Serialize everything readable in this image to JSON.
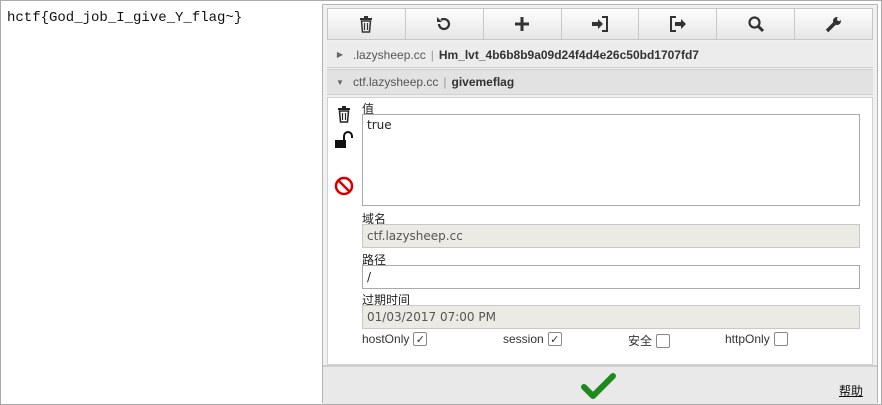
{
  "page": {
    "text": "hctf{God_job_I_give_Y_flag~}"
  },
  "toolbar": {
    "buttons": [
      {
        "name": "delete-all-button",
        "icon": "trash-icon"
      },
      {
        "name": "reset-button",
        "icon": "refresh-icon"
      },
      {
        "name": "add-cookie-button",
        "icon": "plus-icon"
      },
      {
        "name": "import-button",
        "icon": "sign-in-icon"
      },
      {
        "name": "export-button",
        "icon": "sign-out-icon"
      },
      {
        "name": "search-button",
        "icon": "search-icon"
      },
      {
        "name": "settings-button",
        "icon": "wrench-icon"
      }
    ]
  },
  "cookies": [
    {
      "domain": ".lazysheep.cc",
      "sep": "|",
      "name": "Hm_lvt_4b6b8b9a09d24f4d4e26c50bd1707fd7",
      "expanded": false
    },
    {
      "domain": "ctf.lazysheep.cc",
      "sep": "|",
      "name": "givemeflag",
      "expanded": true
    }
  ],
  "editor": {
    "value_label": "值",
    "value": "true",
    "domain_label": "域名",
    "domain": "ctf.lazysheep.cc",
    "path_label": "路径",
    "path": "/",
    "expires_label": "过期时间",
    "expires": "01/03/2017 07:00 PM",
    "flags": {
      "hostonly_label": "hostOnly",
      "hostonly": true,
      "session_label": "session",
      "session": true,
      "secure_label": "安全",
      "secure": false,
      "httponly_label": "httpOnly",
      "httponly": false
    }
  },
  "footer": {
    "help_label": "帮助"
  },
  "colors": {
    "ok_green": "#1e8a1e",
    "block_red": "#d40000"
  }
}
